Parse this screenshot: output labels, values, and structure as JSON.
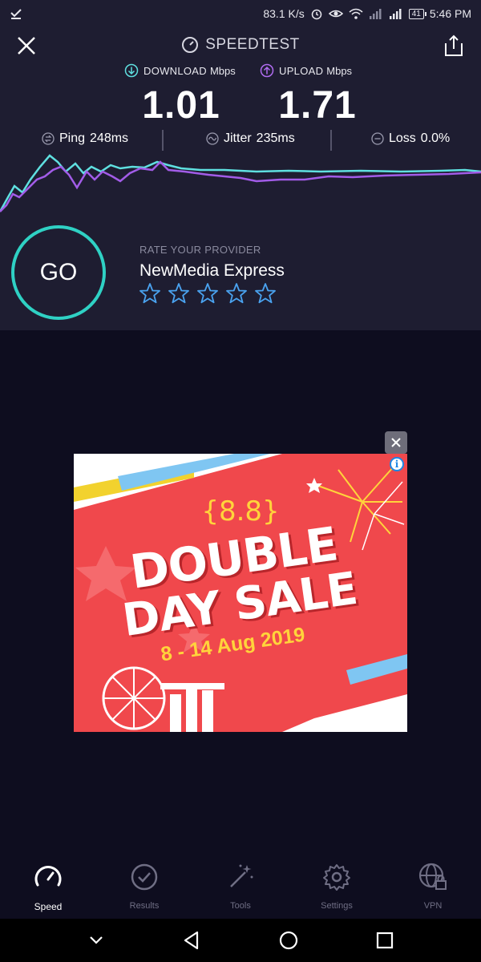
{
  "status_bar": {
    "net_speed": "83.1 K/s",
    "battery": "41",
    "time": "5:46 PM"
  },
  "header": {
    "title": "SPEEDTEST"
  },
  "metrics": {
    "download_label": "DOWNLOAD",
    "download_unit": "Mbps",
    "download_value": "1.01",
    "upload_label": "UPLOAD",
    "upload_unit": "Mbps",
    "upload_value": "1.71",
    "ping_label": "Ping",
    "ping_value": "248ms",
    "jitter_label": "Jitter",
    "jitter_value": "235ms",
    "loss_label": "Loss",
    "loss_value": "0.0%"
  },
  "graph": {
    "download_color": "#5fe0e0",
    "upload_color": "#a25ce8"
  },
  "provider": {
    "go_label": "GO",
    "rate_label": "RATE YOUR PROVIDER",
    "name": "NewMedia Express",
    "rating": 0,
    "max_rating": 5
  },
  "ad": {
    "event": "{8.8}",
    "line1": "DOUBLE",
    "line2": "DAY SALE",
    "dates": "8 - 14 Aug 2019"
  },
  "bottom_nav": {
    "items": [
      {
        "label": "Speed",
        "icon": "speedometer-icon",
        "active": true
      },
      {
        "label": "Results",
        "icon": "check-circle-icon",
        "active": false
      },
      {
        "label": "Tools",
        "icon": "magic-wand-icon",
        "active": false
      },
      {
        "label": "Settings",
        "icon": "gear-icon",
        "active": false
      },
      {
        "label": "VPN",
        "icon": "globe-lock-icon",
        "active": false
      }
    ]
  },
  "colors": {
    "accent": "#2fd1c4",
    "panel_bg": "#1e1d31",
    "page_bg": "#0e0d1f",
    "ad_red": "#f0484c"
  }
}
